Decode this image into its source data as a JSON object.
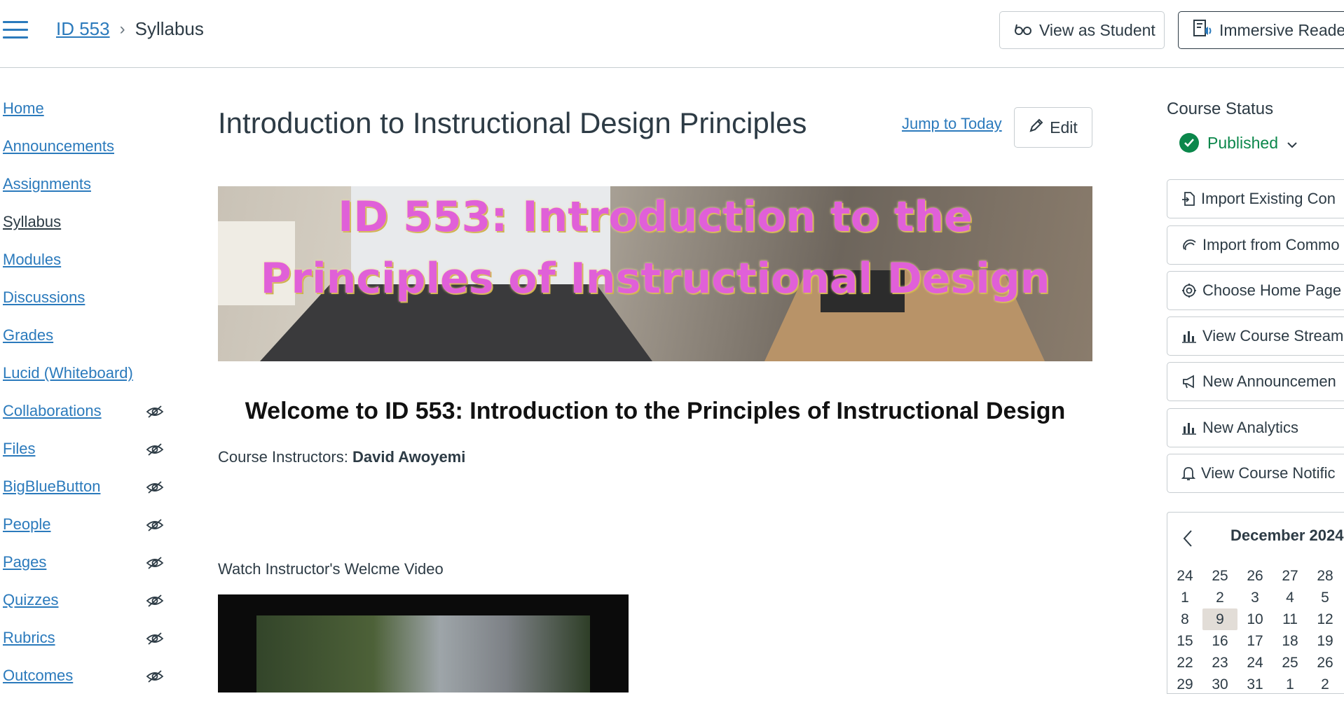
{
  "header": {
    "breadcrumb_course": "ID 553",
    "breadcrumb_page": "Syllabus",
    "view_as_student": "View as Student",
    "immersive_reader": "Immersive Reader"
  },
  "nav": {
    "items": [
      {
        "label": "Home",
        "hidden": false,
        "active": false
      },
      {
        "label": "Announcements",
        "hidden": false,
        "active": false
      },
      {
        "label": "Assignments",
        "hidden": false,
        "active": false
      },
      {
        "label": "Syllabus",
        "hidden": false,
        "active": true
      },
      {
        "label": "Modules",
        "hidden": false,
        "active": false
      },
      {
        "label": "Discussions",
        "hidden": false,
        "active": false
      },
      {
        "label": "Grades",
        "hidden": false,
        "active": false
      },
      {
        "label": "Lucid (Whiteboard)",
        "hidden": false,
        "active": false
      },
      {
        "label": "Collaborations",
        "hidden": true,
        "active": false
      },
      {
        "label": "Files",
        "hidden": true,
        "active": false
      },
      {
        "label": "BigBlueButton",
        "hidden": true,
        "active": false
      },
      {
        "label": "People",
        "hidden": true,
        "active": false
      },
      {
        "label": "Pages",
        "hidden": true,
        "active": false
      },
      {
        "label": "Quizzes",
        "hidden": true,
        "active": false
      },
      {
        "label": "Rubrics",
        "hidden": true,
        "active": false
      },
      {
        "label": "Outcomes",
        "hidden": true,
        "active": false
      }
    ]
  },
  "main": {
    "title": "Introduction to Instructional Design Principles",
    "jump_to_today": "Jump to Today",
    "edit": "Edit",
    "banner_line1": "ID 553: Introduction to the",
    "banner_line2": "Principles of Instructional Design",
    "welcome": "Welcome to ID 553: Introduction to the Principles of Instructional Design",
    "instructors_label": "Course Instructors:",
    "instructor_name": "David Awoyemi",
    "video_label": "Watch Instructor's Welcme Video"
  },
  "sidebar": {
    "course_status": "Course Status",
    "published": "Published",
    "buttons": [
      {
        "label": "Import Existing Con",
        "icon": "import-icon"
      },
      {
        "label": "Import from Commo",
        "icon": "commons-icon"
      },
      {
        "label": "Choose Home Page",
        "icon": "target-icon"
      },
      {
        "label": "View Course Stream",
        "icon": "bar-chart-icon"
      },
      {
        "label": "New Announcemen",
        "icon": "megaphone-icon"
      },
      {
        "label": "New Analytics",
        "icon": "bar-chart-icon"
      },
      {
        "label": "View Course Notific",
        "icon": "bell-icon"
      }
    ]
  },
  "calendar": {
    "month": "December 2024",
    "today": "9",
    "weeks": [
      [
        "24",
        "25",
        "26",
        "27",
        "28"
      ],
      [
        "1",
        "2",
        "3",
        "4",
        "5"
      ],
      [
        "8",
        "9",
        "10",
        "11",
        "12"
      ],
      [
        "15",
        "16",
        "17",
        "18",
        "19"
      ],
      [
        "22",
        "23",
        "24",
        "25",
        "26"
      ],
      [
        "29",
        "30",
        "31",
        "1",
        "2"
      ]
    ]
  },
  "colors": {
    "link": "#2b7abc",
    "published": "#0b874b",
    "banner_text": "#e060d8"
  }
}
